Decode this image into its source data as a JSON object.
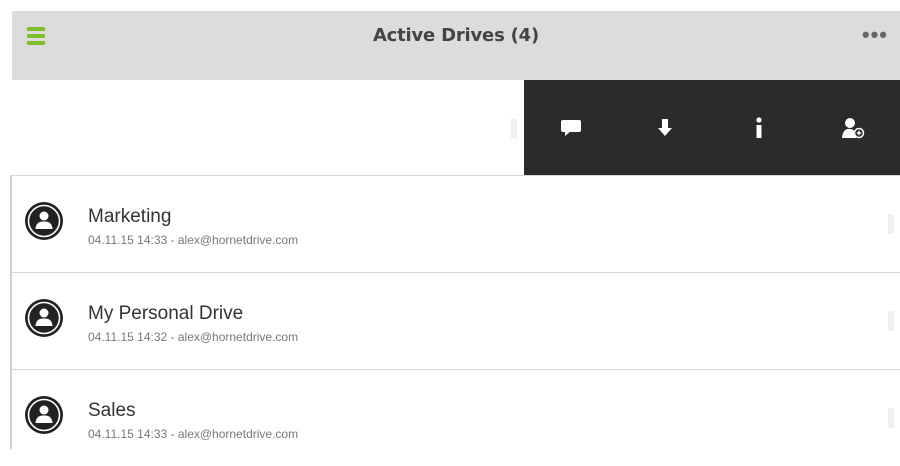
{
  "header": {
    "title": "Active Drives (4)",
    "menu_icon": "hamburger-menu-icon",
    "more_icon": "more-options-icon",
    "more_glyph": "•••",
    "accent": "#7fbf2e",
    "background": "#dcdcdc"
  },
  "action_panel": {
    "background": "#2b2b2b",
    "actions": [
      {
        "icon": "chat-icon"
      },
      {
        "icon": "download-icon"
      },
      {
        "icon": "info-icon"
      },
      {
        "icon": "add-user-icon"
      }
    ]
  },
  "drives": [
    {
      "name": "Marketing",
      "meta": "04.11.15 14:33 - alex@hornetdrive.com"
    },
    {
      "name": "My Personal Drive",
      "meta": "04.11.15 14:32 - alex@hornetdrive.com"
    },
    {
      "name": "Sales",
      "meta": "04.11.15 14:33 - alex@hornetdrive.com"
    }
  ]
}
